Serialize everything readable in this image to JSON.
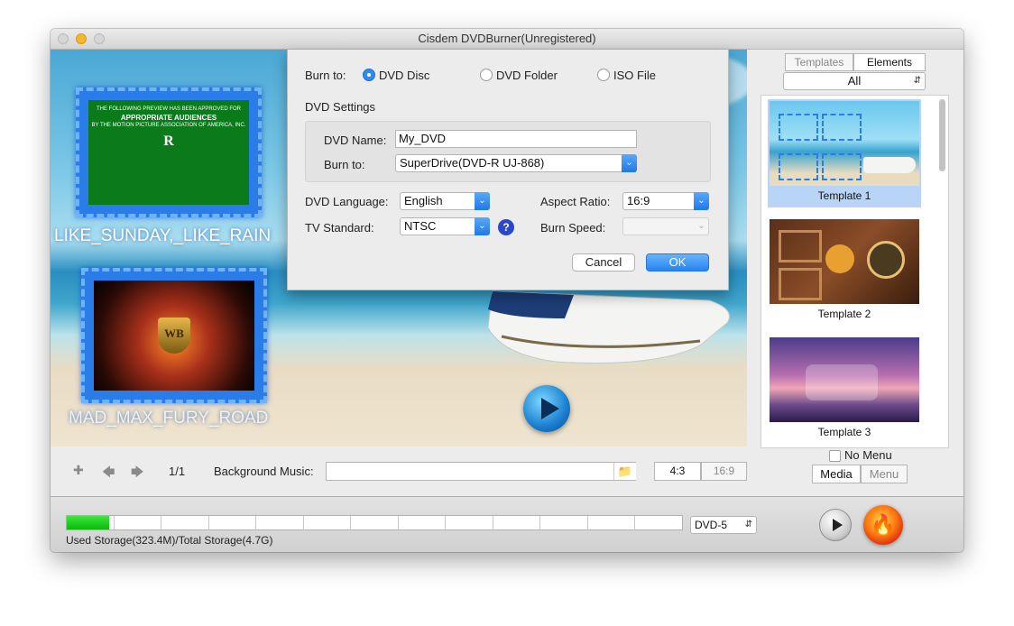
{
  "window": {
    "title": "Cisdem DVDBurner(Unregistered)"
  },
  "preview": {
    "thumbs": [
      {
        "label": "LIKE_SUNDAY,_LIKE_RAIN",
        "rating_line1": "THE FOLLOWING PREVIEW HAS BEEN APPROVED FOR",
        "rating_line2": "APPROPRIATE AUDIENCES",
        "rating_line3": "BY THE MOTION PICTURE ASSOCIATION OF AMERICA, INC.",
        "rating_letter": "R"
      },
      {
        "label": "MAD_MAX_FURY_ROAD",
        "logo": "WB"
      }
    ]
  },
  "dialog": {
    "burn_to_label": "Burn to:",
    "targets": [
      {
        "label": "DVD Disc",
        "selected": true
      },
      {
        "label": "DVD Folder",
        "selected": false
      },
      {
        "label": "ISO File",
        "selected": false
      }
    ],
    "section_title": "DVD Settings",
    "dvd_name_label": "DVD Name:",
    "dvd_name_value": "My_DVD",
    "device_label": "Burn to:",
    "device_value": "SuperDrive(DVD-R   UJ-868)",
    "language_label": "DVD Language:",
    "language_value": "English",
    "aspect_label": "Aspect Ratio:",
    "aspect_value": "16:9",
    "tv_label": "TV Standard:",
    "tv_value": "NTSC",
    "help": "?",
    "speed_label": "Burn Speed:",
    "speed_value": "",
    "cancel": "Cancel",
    "ok": "OK"
  },
  "right_panel": {
    "tabs": [
      {
        "label": "Templates",
        "active": false
      },
      {
        "label": "Elements",
        "active": true
      }
    ],
    "filter_value": "All",
    "templates": [
      {
        "name": "Template 1",
        "selected": true
      },
      {
        "name": "Template 2",
        "selected": false
      },
      {
        "name": "Template 3",
        "selected": false
      }
    ],
    "no_menu_label": "No Menu",
    "bottom_tabs": [
      {
        "label": "Media",
        "active": true
      },
      {
        "label": "Menu",
        "active": false
      }
    ]
  },
  "controls": {
    "page": "1/1",
    "bg_music_label": "Background Music:",
    "bg_music_value": "",
    "ratio_options": [
      {
        "label": "4:3",
        "active": true
      },
      {
        "label": "16:9",
        "active": false
      }
    ]
  },
  "storage": {
    "used_fraction": 0.069,
    "text": "Used Storage(323.4M)/Total Storage(4.7G)",
    "disc_type": "DVD-5"
  },
  "colors": {
    "accent": "#2584f2",
    "storage_fill": "#19c619",
    "rating_green": "#0a7a1a"
  }
}
